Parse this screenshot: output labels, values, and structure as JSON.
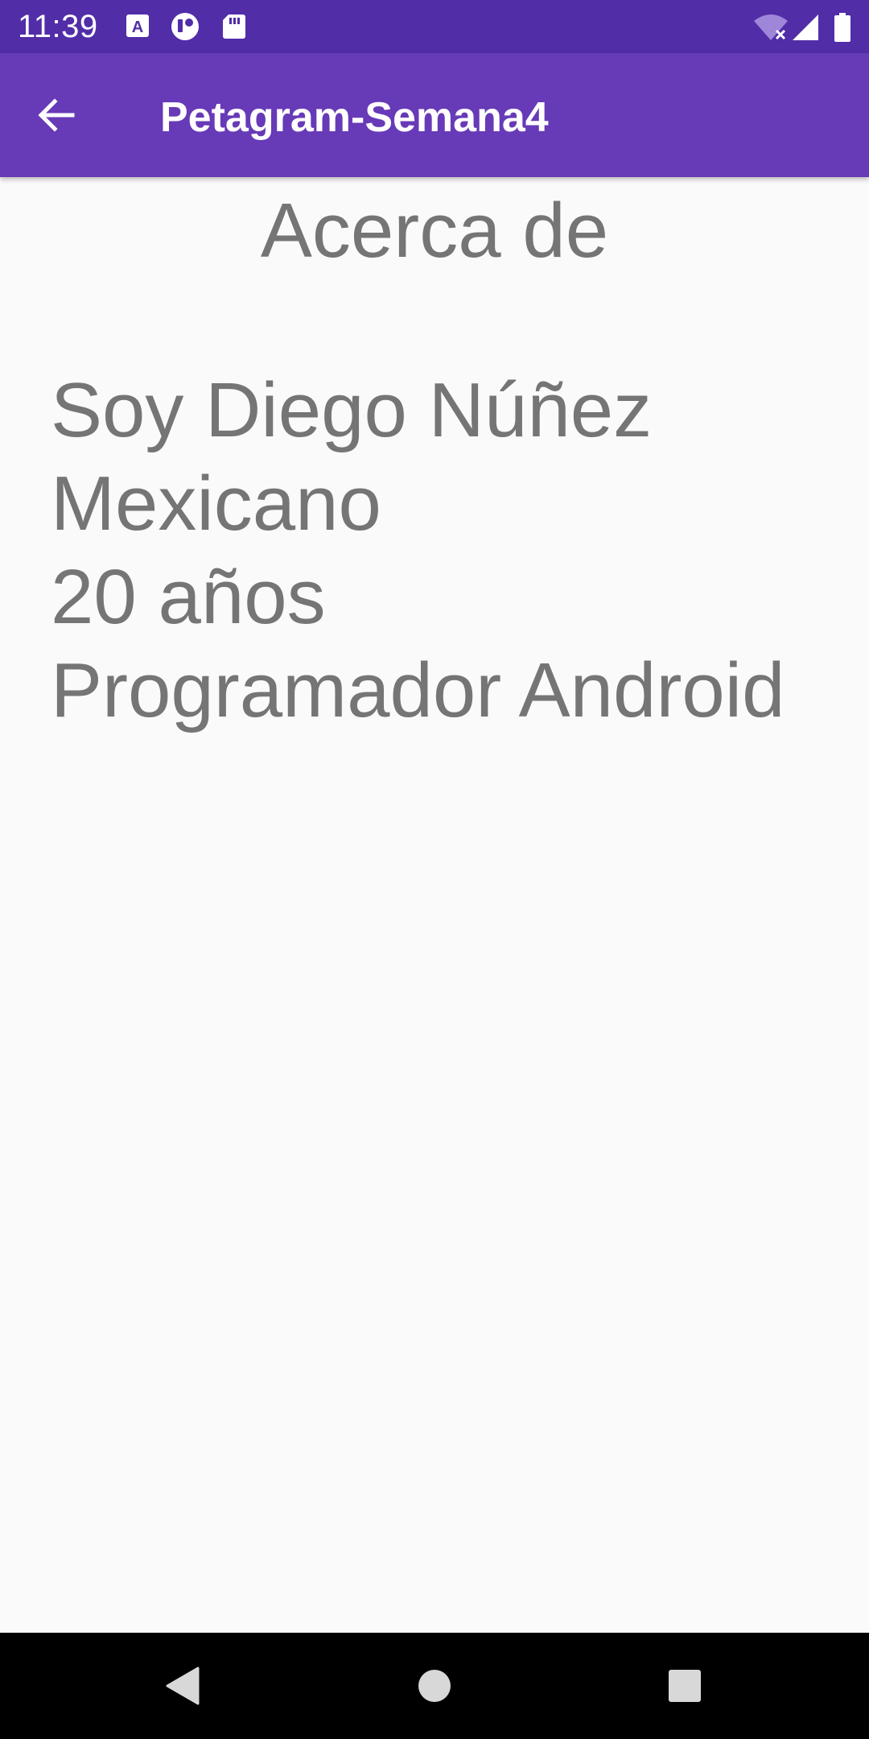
{
  "status_bar": {
    "time": "11:39",
    "icons": [
      "accessibility-a-icon",
      "vpn-circle-icon",
      "sd-card-icon",
      "wifi-off-icon",
      "cellular-signal-icon",
      "battery-icon"
    ],
    "bg_color": "#512da8"
  },
  "app_bar": {
    "title": "Petagram-Semana4",
    "back_icon": "arrow-back-icon",
    "bg_color": "#673ab7"
  },
  "content": {
    "heading": "Acerca de",
    "bio_lines": [
      "Soy Diego Núñez",
      "Mexicano",
      "20 años",
      "Programador Android"
    ],
    "text_color": "#757575"
  },
  "nav_bar": {
    "buttons": [
      "back-triangle-icon",
      "home-circle-icon",
      "recents-square-icon"
    ]
  }
}
